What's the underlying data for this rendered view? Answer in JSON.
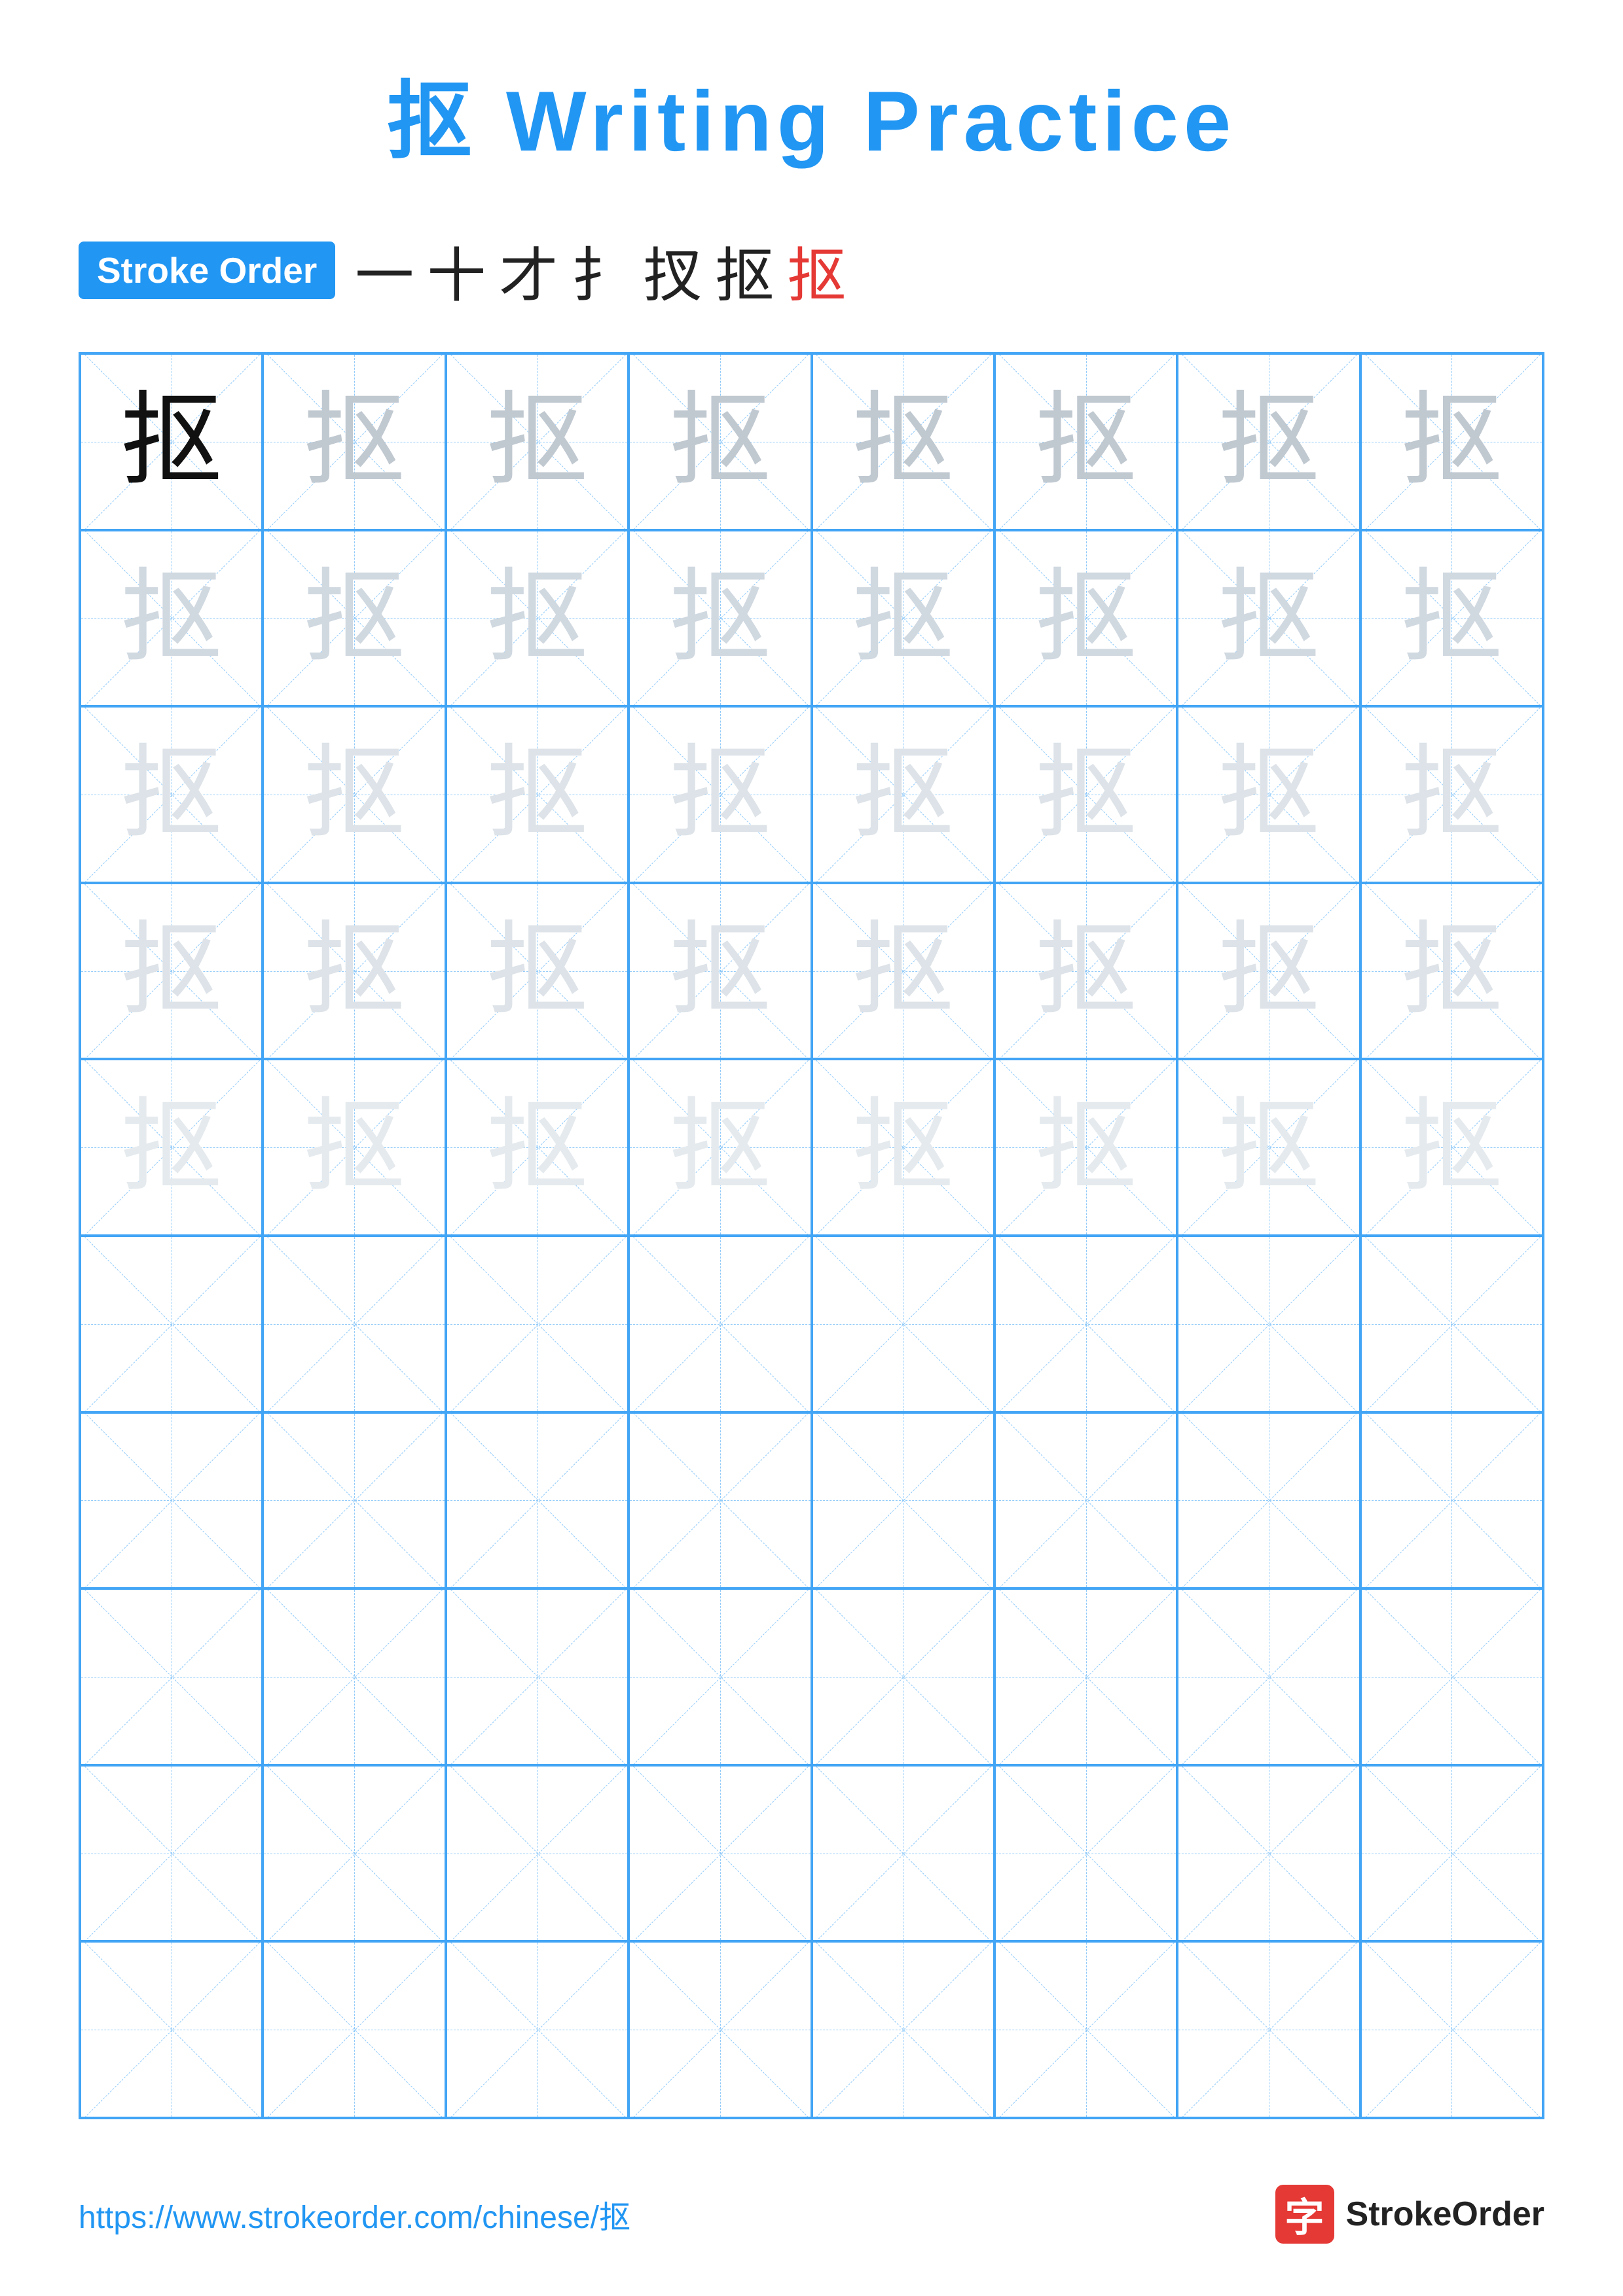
{
  "title": {
    "char": "抠",
    "text": "Writing Practice",
    "full": "抠 Writing Practice"
  },
  "stroke_order": {
    "badge_label": "Stroke Order",
    "strokes": [
      "一",
      "十",
      "才",
      "扌",
      "扠",
      "抠",
      "抠"
    ]
  },
  "grid": {
    "cols": 8,
    "rows": 10,
    "char": "抠",
    "filled_rows": 5
  },
  "footer": {
    "url": "https://www.strokeorder.com/chinese/抠",
    "logo_text": "StrokeOrder",
    "logo_char": "字"
  },
  "colors": {
    "blue": "#2196F3",
    "red": "#e53935",
    "dark": "#111",
    "light1": "#C0C8D0",
    "light2": "#D0D8E0",
    "light3": "#DDE3E8",
    "light4": "#E5EAEE"
  }
}
